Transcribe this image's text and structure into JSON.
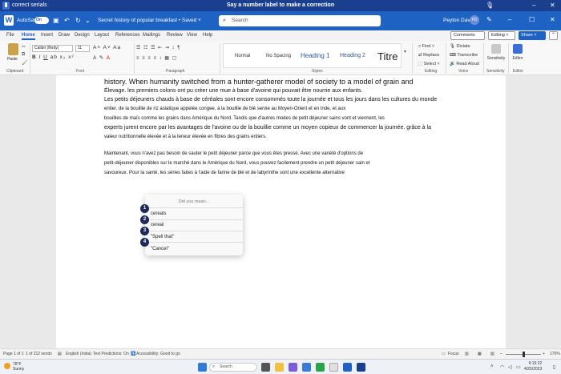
{
  "voice_strip": {
    "document_name": "correct serials",
    "hint": "Say a number label to make a correction"
  },
  "titlebar": {
    "autosave_label": "AutoSave",
    "autosave_state": "On",
    "doc_title": "Secret history of popular breakfast • Saved ˅",
    "search_placeholder": "Search",
    "user_name": "Peyton Davis",
    "user_initials": "PD"
  },
  "tabs": [
    "File",
    "Home",
    "Insert",
    "Draw",
    "Design",
    "Layout",
    "References",
    "Mailings",
    "Review",
    "View",
    "Help"
  ],
  "tab_buttons": {
    "comments": "Comments",
    "editing": "Editing ˅",
    "share": "Share ˅"
  },
  "ribbon": {
    "paste_label": "Paste",
    "font_name": "Calibri (Body)",
    "font_size": "11",
    "styles": [
      "Normal",
      "No Spacing",
      "Heading 1",
      "Heading 2",
      "Titre"
    ],
    "editing_items": [
      "Find ˅",
      "Replace",
      "Select ˅"
    ],
    "voice_items": [
      "Dictate",
      "Transcribe",
      "Read Aloud"
    ],
    "sensitivity_label": "Sensitivity",
    "editor_label": "Editor",
    "group_labels": [
      "Clipboard",
      "Font",
      "Paragraph",
      "Styles",
      "Editing",
      "Voice",
      "Sensitivity",
      "Editor"
    ]
  },
  "document": {
    "lines": [
      {
        "size": "big",
        "text": "history. When humanity switched from a hunter-gatherer model of society to a model of grain and"
      },
      {
        "size": "mid",
        "text": "Élevage. les premiers colons ont pu créer une mue à base d'avoine qui pouvait être nourrie aux enfants."
      },
      {
        "size": "mid",
        "text": "Les petits déjeuners chauds à base de céréales sont encore consommés toute la journée et tous les jours dans les cultures du monde"
      },
      {
        "size": "sm",
        "text": "entier. de la bouillie de riz asiatique appelée congee, à la bouillie de blé servie au Moyen-Orient et en Inde, et aux"
      },
      {
        "size": "sm",
        "text": "bouillies de maïs comme les grains dans Amérique du Nord. Tandis que d'autres modes de petit déjeuner sains vont et viennent, les"
      },
      {
        "size": "mid",
        "text": "experts jurent encore par les avantages de l'avoine ou de la bouillie comme un moyen copieux de commencer la journée. grâce à la"
      },
      {
        "size": "sm",
        "text": "valeur nutritionnelle élevée et à la teneur élevée en fibres des grains entiers."
      },
      {
        "size": "gap",
        "text": ""
      },
      {
        "size": "sm",
        "text": "Maintenant, vous n'avez pas besoin de sauter le petit déjeuner parce que vous êtes pressé. Avec une variété d'options de"
      },
      {
        "size": "sm",
        "text": "petit-déjeuner disponibles sur le marché dans le Amérique du Nord, vous pouvez facilement prendre un petit déjeuner sain et"
      },
      {
        "size": "sm",
        "text": "savoureux. Pour la santé, les séries faites à l'aide de farine de blé et de labyrinthe sont une excellente alternative"
      }
    ]
  },
  "popup": {
    "title": "Did you mean...",
    "options": [
      {
        "number": "1",
        "label": "cereals"
      },
      {
        "number": "2",
        "label": "cereal"
      },
      {
        "number": "3",
        "label": "\"Spell that\""
      },
      {
        "number": "4",
        "label": "\"Cancel\""
      }
    ]
  },
  "statusbar": {
    "page": "Page 1 of 1",
    "words": "1 of 212 words",
    "language": "English (India)",
    "text_predictions": "Text Predictions: On",
    "accessibility": "Accessibility: Good to go",
    "focus": "Focus",
    "zoom": "170%"
  },
  "taskbar": {
    "temperature": "78°F",
    "condition": "Sunny",
    "search_placeholder": "Search",
    "time": "9:15:22",
    "date": "4/25/2023"
  },
  "colors": {
    "accent": "#1e63c4",
    "voice_strip": "#1a3f8f",
    "badge": "#1e2a5a"
  }
}
